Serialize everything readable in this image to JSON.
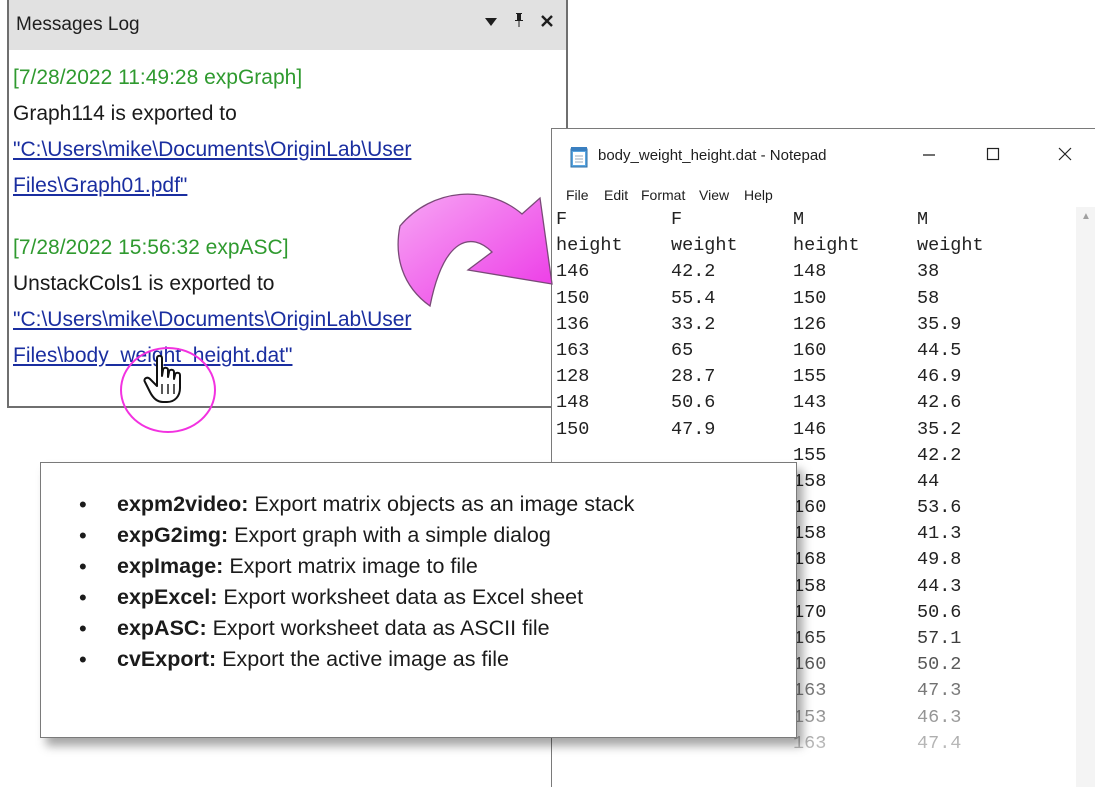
{
  "messages_log": {
    "title": "Messages Log",
    "entries": [
      {
        "timestamp": "[7/28/2022 11:49:28 expGraph]",
        "text": "Graph114 is exported to",
        "link_line1": "\"C:\\Users\\mike\\Documents\\OriginLab\\User",
        "link_line2": "Files\\Graph01.pdf\""
      },
      {
        "timestamp": "[7/28/2022 15:56:32 expASC]",
        "text": "UnstackCols1 is exported to",
        "link_line1": "\"C:\\Users\\mike\\Documents\\OriginLab\\User",
        "link_line2": "Files\\body_weight_height.dat\""
      }
    ]
  },
  "notepad": {
    "title": "body_weight_height.dat - Notepad",
    "menu": [
      "File",
      "Edit",
      "Format",
      "View",
      "Help"
    ],
    "rows": [
      [
        "F",
        "F",
        "M",
        "M"
      ],
      [
        "height",
        "weight",
        "height",
        "weight"
      ],
      [
        "146",
        "42.2",
        "148",
        "38"
      ],
      [
        "150",
        "55.4",
        "150",
        "58"
      ],
      [
        "136",
        "33.2",
        "126",
        "35.9"
      ],
      [
        "163",
        "65",
        "160",
        "44.5"
      ],
      [
        "128",
        "28.7",
        "155",
        "46.9"
      ],
      [
        "148",
        "50.6",
        "143",
        "42.6"
      ],
      [
        "150",
        "47.9",
        "146",
        "35.2"
      ],
      [
        "",
        "",
        "155",
        "42.2"
      ],
      [
        "",
        "",
        "158",
        "44"
      ],
      [
        "",
        "",
        "160",
        "53.6"
      ],
      [
        "",
        "",
        "158",
        "41.3"
      ],
      [
        "",
        "",
        "168",
        "49.8"
      ],
      [
        "",
        "",
        "158",
        "44.3"
      ],
      [
        "",
        "",
        "170",
        "50.6"
      ],
      [
        "",
        "",
        "165",
        "57.1"
      ],
      [
        "",
        "",
        "160",
        "50.2"
      ],
      [
        "",
        "",
        "163",
        "47.3"
      ],
      [
        "",
        "",
        "153",
        "46.3"
      ],
      [
        "",
        "",
        "163",
        "47.4"
      ]
    ]
  },
  "functions": [
    {
      "name": "expm2video:",
      "desc": " Export matrix objects as an image stack"
    },
    {
      "name": "expG2img:",
      "desc": " Export graph with a simple dialog"
    },
    {
      "name": "expImage:",
      "desc": " Export matrix image to file"
    },
    {
      "name": "expExcel:",
      "desc": " Export worksheet data as Excel sheet"
    },
    {
      "name": "expASC:",
      "desc": " Export worksheet data as ASCII file"
    },
    {
      "name": "cvExport:",
      "desc": " Export the active image as file"
    }
  ],
  "colors": {
    "timestamp": "#2f9a2f",
    "link": "#1a2ea0",
    "highlight": "#f232e0"
  }
}
